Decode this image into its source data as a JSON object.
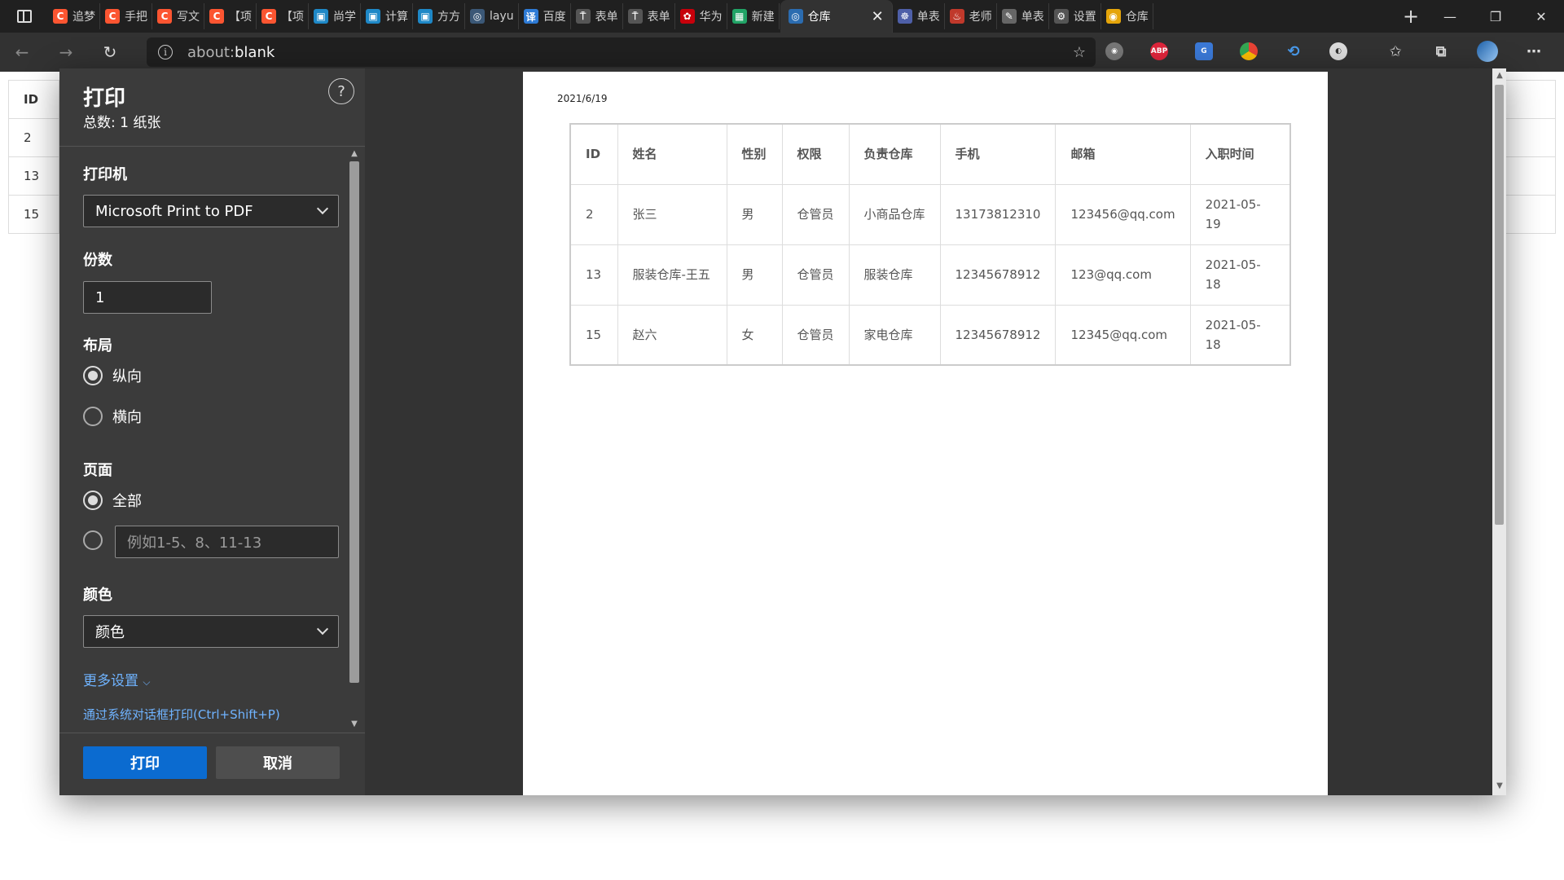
{
  "browser": {
    "tabs": [
      {
        "label": "追梦",
        "fav": "C",
        "color": "#fc5531"
      },
      {
        "label": "手把",
        "fav": "C",
        "color": "#fc5531"
      },
      {
        "label": "写文",
        "fav": "C",
        "color": "#fc5531"
      },
      {
        "label": "【项",
        "fav": "C",
        "color": "#fc5531"
      },
      {
        "label": "【项",
        "fav": "C",
        "color": "#fc5531"
      },
      {
        "label": "尚学",
        "fav": "▣",
        "color": "#1e88c7"
      },
      {
        "label": "计算",
        "fav": "▣",
        "color": "#1e88c7"
      },
      {
        "label": "方方",
        "fav": "▣",
        "color": "#1e88c7"
      },
      {
        "label": "layu",
        "fav": "◎",
        "color": "#3b5877"
      },
      {
        "label": "百度",
        "fav": "译",
        "color": "#2e7bd6"
      },
      {
        "label": "表单",
        "fav": "⍑",
        "color": "#555555"
      },
      {
        "label": "表单",
        "fav": "⍑",
        "color": "#555555"
      },
      {
        "label": "华为",
        "fav": "✿",
        "color": "#c7000b"
      },
      {
        "label": "新建",
        "fav": "▦",
        "color": "#21a366"
      }
    ],
    "active_tab": {
      "label": "仓库",
      "fav": "◎",
      "color": "#2b6cb0"
    },
    "tabs_after": [
      {
        "label": "单表",
        "fav": "☸",
        "color": "#4e5fa8"
      },
      {
        "label": "老师",
        "fav": "♨",
        "color": "#c0392b"
      },
      {
        "label": "单表",
        "fav": "✎",
        "color": "#666666"
      },
      {
        "label": "设置",
        "fav": "⚙",
        "color": "#555555"
      },
      {
        "label": "仓库",
        "fav": "◉",
        "color": "#e5a50a"
      }
    ],
    "url_prefix": "about:",
    "url_main": "blank",
    "ext_abp": "ABP"
  },
  "background_table": {
    "rows": [
      "ID",
      "2",
      "13",
      "15"
    ]
  },
  "print": {
    "title": "打印",
    "subtitle": "总数: 1 纸张",
    "help": "?",
    "printer_label": "打印机",
    "printer_value": "Microsoft Print to PDF",
    "copies_label": "份数",
    "copies_value": "1",
    "layout_label": "布局",
    "layout_portrait": "纵向",
    "layout_landscape": "横向",
    "pages_label": "页面",
    "pages_all": "全部",
    "pages_placeholder": "例如1-5、8、11-13",
    "color_label": "颜色",
    "color_value": "颜色",
    "more_settings": "更多设置",
    "system_dialog": "通过系统对话框打印(Ctrl+Shift+P)",
    "print_button": "打印",
    "cancel_button": "取消"
  },
  "preview": {
    "date": "2021/6/19",
    "headers": [
      "ID",
      "姓名",
      "性别",
      "权限",
      "负责仓库",
      "手机",
      "邮箱",
      "入职时间"
    ],
    "rows": [
      [
        "2",
        "张三",
        "男",
        "仓管员",
        "小商品仓库",
        "13173812310",
        "123456@qq.com",
        "2021-05-19"
      ],
      [
        "13",
        "服装仓库-王五",
        "男",
        "仓管员",
        "服装仓库",
        "12345678912",
        "123@qq.com",
        "2021-05-18"
      ],
      [
        "15",
        "赵六",
        "女",
        "仓管员",
        "家电仓库",
        "12345678912",
        "12345@qq.com",
        "2021-05-18"
      ]
    ]
  }
}
